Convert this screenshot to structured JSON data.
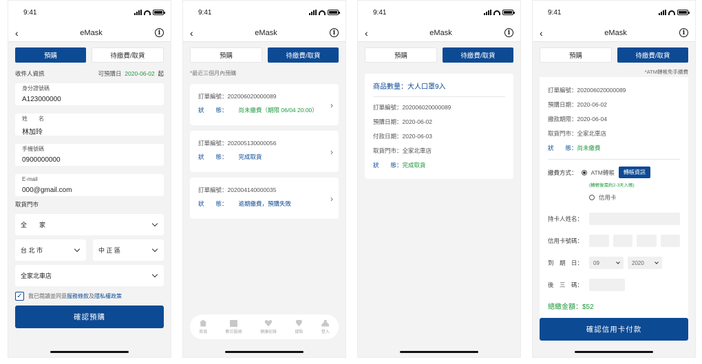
{
  "status": {
    "time": "9:41"
  },
  "app": {
    "title": "eMask"
  },
  "tabs": {
    "reserve": "預購",
    "pending": "待繳費/取貨"
  },
  "screen1": {
    "recipient_heading": "收件人資訊",
    "available_label": "可預購日",
    "available_date": "2020-06-02",
    "available_suffix": "起",
    "id_label": "身分證號碼",
    "id_value": "A123000000",
    "name_label": "姓　　名",
    "name_value": "林加玲",
    "phone_label": "手機號碼",
    "phone_value": "0900000000",
    "email_label": "E-mail",
    "email_value": "000@gmail.com",
    "store_heading": "取貨門市",
    "chain": "全　　家",
    "city": "台 北 市",
    "district": "中 正 區",
    "store": "全家北車店",
    "agree_prefix": "我已閱讀並同意",
    "terms_link": "服務條款",
    "and": "及",
    "privacy_link": "隱私權政策",
    "confirm": "確認預購"
  },
  "screen2": {
    "hint": "*最近三個月內預購",
    "orders": [
      {
        "no_label": "訂單編號：",
        "no": "202006020000089",
        "status_label": "狀　　態：",
        "status": "尚未繳費（期限 06/04 20:00）",
        "status_color": "green"
      },
      {
        "no_label": "訂單編號：",
        "no": "202005130000056",
        "status_label": "狀　　態：",
        "status": "完成取貨",
        "status_color": "blue"
      },
      {
        "no_label": "訂單編號：",
        "no": "202004140000035",
        "status_label": "狀　　態：",
        "status": "逾期繳費，預購失敗",
        "status_color": "blue"
      }
    ],
    "bottom_nav": [
      "首頁",
      "數位服務",
      "健康紀錄",
      "據點",
      "登入"
    ]
  },
  "screen3": {
    "title": "商品數量：大人口罩9入",
    "order_no": "訂單編號：202006020000089",
    "reserve_date": "預購日期：2020-06-02",
    "pay_date": "付款日期：2020-06-03",
    "store": "取貨門市：全家北車店",
    "status_label": "狀　　態：",
    "status": "完成取貨"
  },
  "screen4": {
    "atm_note": "*ATM轉帳免手續費",
    "order_no": "訂單編號：202006020000089",
    "reserve_date": "預購日期：2020-06-02",
    "due_date": "繳款期限：2020-06-04",
    "store": "取貨門市：全家北車店",
    "status_label": "狀　　態：",
    "status": "尚未繳費",
    "pay_method_label": "繳費方式：",
    "atm": "ATM轉帳",
    "transfer_info": "轉帳資訊",
    "atm_hint": "(轉帳後需約2-3天入帳)",
    "credit": "信用卡",
    "holder_label": "持卡人姓名：",
    "card_label": "信用卡號碼：",
    "expiry_label": "到　期　日：",
    "month": "09",
    "year": "2020",
    "cvv_label": "後　三　碼：",
    "total": "總繳金額：$52",
    "confirm": "確認信用卡付款"
  },
  "colors": {
    "primary": "#0d4a94",
    "success": "#1f9a3d"
  }
}
